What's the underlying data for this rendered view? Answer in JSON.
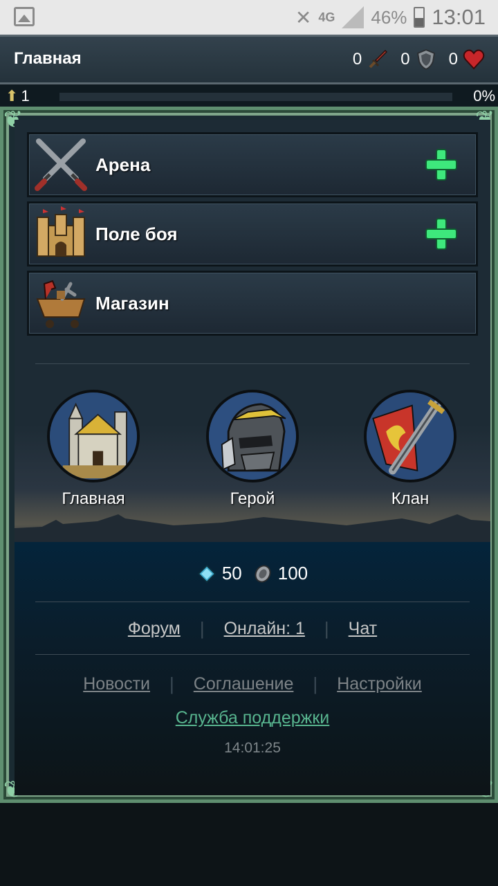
{
  "status_bar": {
    "network": "4G",
    "battery": "46%",
    "time": "13:01",
    "icons": [
      "gallery-icon",
      "mute-icon",
      "signal-icon",
      "battery-icon"
    ]
  },
  "header": {
    "title": "Главная",
    "attack": "0",
    "defense": "0",
    "health": "0"
  },
  "level": {
    "value": "1",
    "progress_label": "0%",
    "progress_fraction": 0
  },
  "menu": [
    {
      "label": "Арена",
      "icon": "crossed-swords-icon",
      "has_plus": true
    },
    {
      "label": "Поле боя",
      "icon": "fortress-icon",
      "has_plus": true
    },
    {
      "label": "Магазин",
      "icon": "shop-cart-icon",
      "has_plus": false
    }
  ],
  "nav": [
    {
      "label": "Главная",
      "icon": "town-icon"
    },
    {
      "label": "Герой",
      "icon": "hero-helmet-icon"
    },
    {
      "label": "Клан",
      "icon": "clan-banner-icon"
    }
  ],
  "currency": {
    "gems": "50",
    "silver": "100"
  },
  "links_primary": {
    "forum": "Форум",
    "online": "Онлайн: 1",
    "chat": "Чат"
  },
  "links_secondary": {
    "news": "Новости",
    "agreement": "Соглашение",
    "settings": "Настройки"
  },
  "support": "Служба поддержки",
  "server_time": "14:01:25",
  "colors": {
    "accent_green": "#58b58f",
    "frame_green": "#5f8f70",
    "plus_green": "#3ee87c"
  }
}
